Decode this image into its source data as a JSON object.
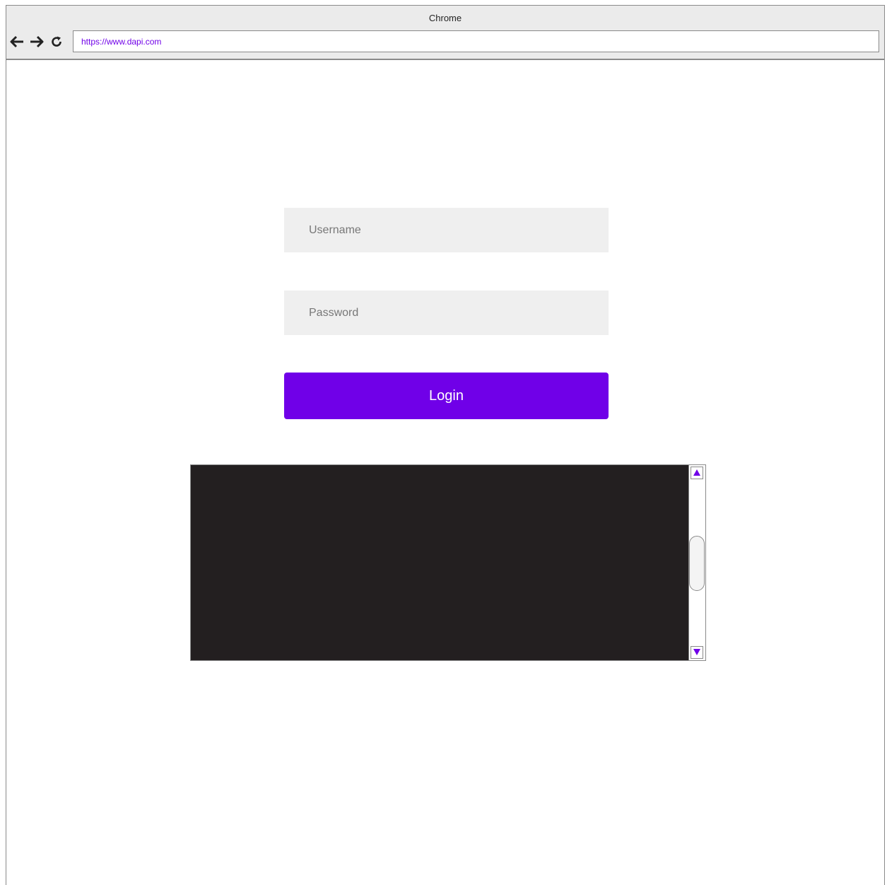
{
  "window": {
    "title": "Chrome"
  },
  "toolbar": {
    "back_icon": "arrow-left-icon",
    "forward_icon": "arrow-right-icon",
    "reload_icon": "reload-icon",
    "url": "https://www.dapi.com"
  },
  "login": {
    "username_placeholder": "Username",
    "password_placeholder": "Password",
    "button_label": "Login"
  },
  "console": {
    "scroll_up_icon": "triangle-up-icon",
    "scroll_down_icon": "triangle-down-icon"
  },
  "colors": {
    "accent": "#7000e8",
    "console_background": "#231f20",
    "field_background": "#efefef",
    "chrome_background": "#ebebeb"
  }
}
